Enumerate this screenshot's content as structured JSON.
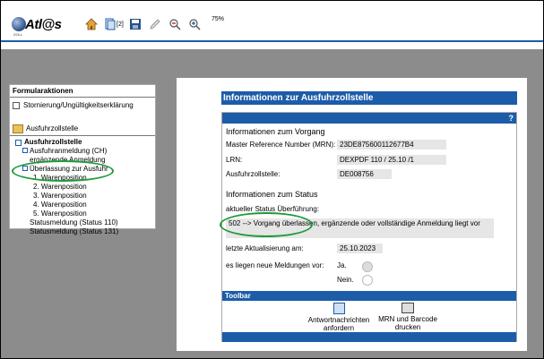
{
  "app": {
    "logo_text": "Atl@s",
    "logo_sub": "ZOLL",
    "zoom_level": "75%",
    "page_count": "[2]"
  },
  "left_panel": {
    "header": "Formularaktionen",
    "action_item": "Stornierung/Ungültigkeitserklärung",
    "folder_label": "Ausfuhrzollstelle",
    "tree": {
      "root": "Ausfuhrzollstelle",
      "items": [
        "Ausfuhranmeldung (CH)",
        "ergänzende Anmeldung",
        "Überlassung zur Ausfuhr",
        "1. Warenposition",
        "2. Warenposition",
        "3. Warenposition",
        "4. Warenposition",
        "5. Warenposition",
        "Statusmeldung (Status 110)",
        "Statusmeldung (Status 131)"
      ]
    }
  },
  "main": {
    "title": "Informationen zur Ausfuhrzollstelle",
    "help": "?",
    "section1": "Informationen zum Vorgang",
    "mrn_label": "Master Reference Number (MRN):",
    "mrn_value": "23DE875600112677B4",
    "lrn_label": "LRN:",
    "lrn_value": "DEXPDF 110 / 25.10 /1",
    "office_label": "Ausfuhrzollstelle:",
    "office_value": "DE008756",
    "section2": "Informationen zum Status",
    "status_label": "aktueller Status Überführung:",
    "status_value": "502 --> Vorgang überlassen, ergänzende oder vollständige Anmeldung liegt vor",
    "update_label": "letzte Aktualisierung am:",
    "update_value": "25.10.2023",
    "messages_label": "es liegen neue Meldungen vor:",
    "radio_yes": "Ja.",
    "radio_no": "Nein.",
    "toolbar_label": "Toolbar",
    "btn_answers_line1": "Antwortnachrichten",
    "btn_answers_line2": "anfordern",
    "btn_print_line1": "MRN und Barcode",
    "btn_print_line2": "drucken"
  },
  "colors": {
    "accent": "#1d5ca8",
    "highlight": "#1f9a3a"
  }
}
